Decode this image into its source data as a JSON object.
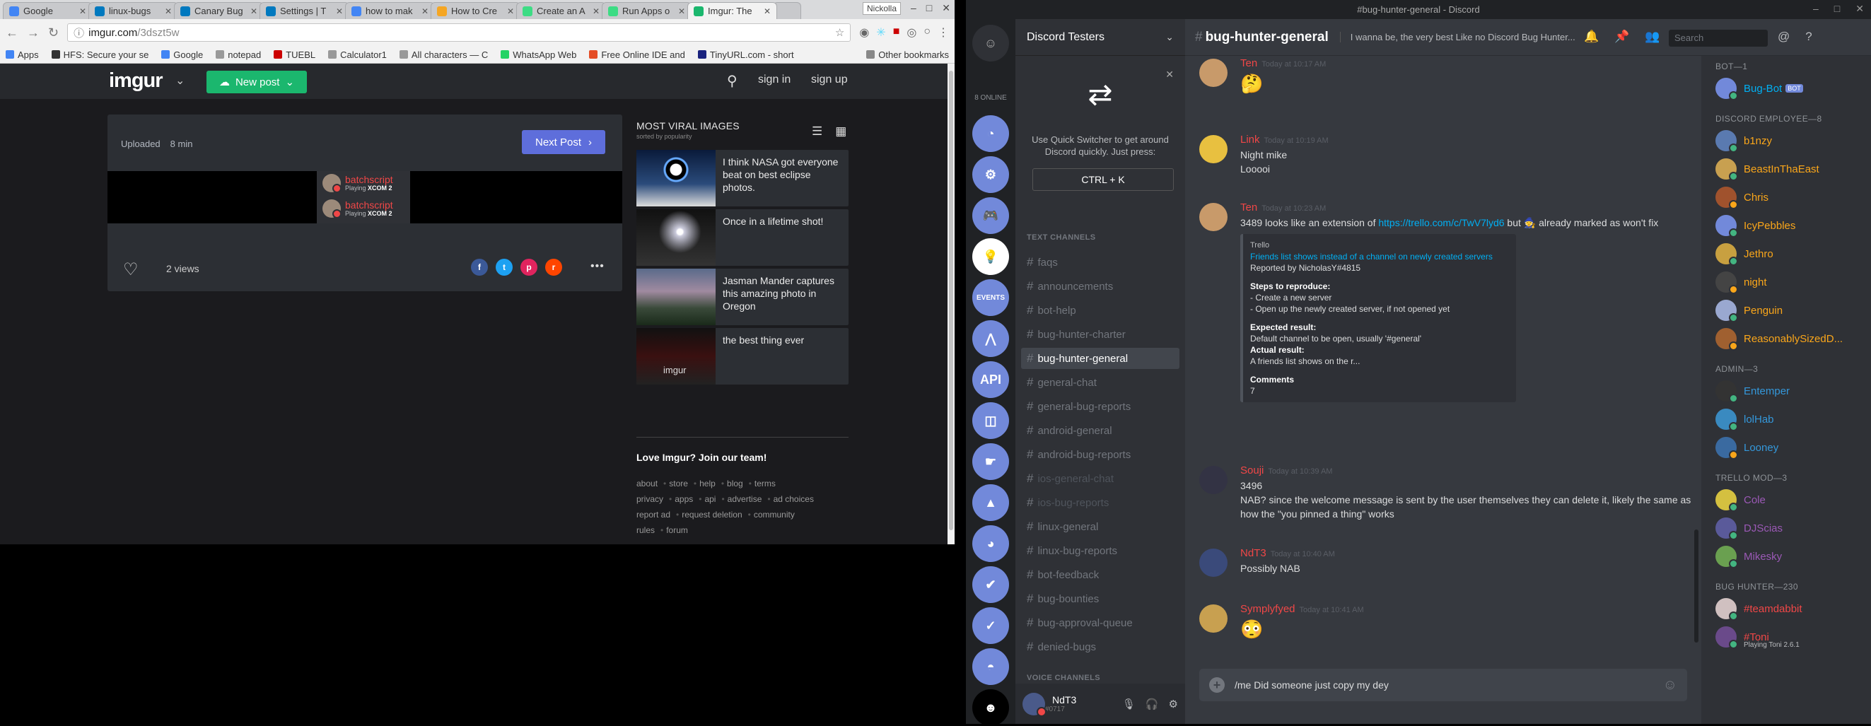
{
  "browser": {
    "tabs": [
      {
        "label": "Google",
        "color": "#4285f4"
      },
      {
        "label": "linux-bugs",
        "color": "#0079bf"
      },
      {
        "label": "Canary Bug",
        "color": "#0079bf"
      },
      {
        "label": "Settings | T",
        "color": "#0079bf"
      },
      {
        "label": "how to mak",
        "color": "#4285f4"
      },
      {
        "label": "How to Cre",
        "color": "#f5a623"
      },
      {
        "label": "Create an A",
        "color": "#3ddc84"
      },
      {
        "label": "Run Apps o",
        "color": "#3ddc84"
      },
      {
        "label": "Imgur: The",
        "color": "#1bb76e"
      }
    ],
    "profile": "Nickolla",
    "url_host": "imgur.com",
    "url_path": "/3dszt5w",
    "bookmarks": [
      "Apps",
      "HFS: Secure your se",
      "Google",
      "notepad",
      "TUEBL",
      "Calculator1",
      "All characters — C",
      "WhatsApp Web",
      "Free Online IDE and",
      "TinyURL.com - short"
    ],
    "other_bookmarks": "Other bookmarks"
  },
  "imgur": {
    "logo": "imgur",
    "new_post": "New post",
    "sign_in": "sign in",
    "sign_up": "sign up",
    "uploaded_label": "Uploaded",
    "uploaded_time": "8 min",
    "next_post": "Next Post",
    "players": [
      {
        "name": "batchscript",
        "playing": "Playing",
        "game": "XCOM 2"
      },
      {
        "name": "batchscript",
        "playing": "Playing",
        "game": "XCOM 2"
      }
    ],
    "views": "2 views",
    "share_icons": [
      {
        "glyph": "f",
        "color": "#3b5998"
      },
      {
        "glyph": "t",
        "color": "#1da1f2"
      },
      {
        "glyph": "p",
        "color": "#e0245e"
      },
      {
        "glyph": "r",
        "color": "#ff4500"
      }
    ],
    "viral_title": "MOST VIRAL IMAGES",
    "viral_sub": "sorted by popularity",
    "viral": [
      {
        "caption": "I think NASA got everyone beat on best eclipse photos."
      },
      {
        "caption": "Once in a lifetime shot!"
      },
      {
        "caption": "Jasman Mander captures this amazing photo in Oregon"
      },
      {
        "caption": "the best thing ever",
        "overlay": "imgur"
      }
    ],
    "join": "Love Imgur? Join our team!",
    "footer_links": [
      "about",
      "store",
      "help",
      "blog",
      "terms",
      "privacy",
      "apps",
      "api",
      "advertise",
      "ad choices",
      "report ad",
      "request deletion",
      "community rules",
      "forum"
    ]
  },
  "discord": {
    "window_title": "#bug-hunter-general - Discord",
    "online": "8 ONLINE",
    "server_name": "Discord Testers",
    "quick_switcher": "Use Quick Switcher to get around Discord quickly. Just press:",
    "shortcut": "CTRL + K",
    "text_channels_label": "TEXT CHANNELS",
    "voice_channels_label": "VOICE CHANNELS",
    "channels": [
      {
        "name": "faqs",
        "state": "normal"
      },
      {
        "name": "announcements",
        "state": "normal"
      },
      {
        "name": "bot-help",
        "state": "normal"
      },
      {
        "name": "bug-hunter-charter",
        "state": "normal"
      },
      {
        "name": "bug-hunter-general",
        "state": "selected"
      },
      {
        "name": "general-chat",
        "state": "normal"
      },
      {
        "name": "general-bug-reports",
        "state": "normal"
      },
      {
        "name": "android-general",
        "state": "normal"
      },
      {
        "name": "android-bug-reports",
        "state": "normal"
      },
      {
        "name": "ios-general-chat",
        "state": "dim"
      },
      {
        "name": "ios-bug-reports",
        "state": "dim"
      },
      {
        "name": "linux-general",
        "state": "normal"
      },
      {
        "name": "linux-bug-reports",
        "state": "normal"
      },
      {
        "name": "bot-feedback",
        "state": "normal"
      },
      {
        "name": "bug-bounties",
        "state": "normal"
      },
      {
        "name": "bug-approval-queue",
        "state": "normal"
      },
      {
        "name": "denied-bugs",
        "state": "normal"
      }
    ],
    "user": {
      "name": "NdT3",
      "discriminator": "#0717"
    },
    "channel_name": "bug-hunter-general",
    "topic": "I wanna be, the very best Like no Discord Bug Hunter...",
    "search_placeholder": "Search",
    "messages": [
      {
        "author": "Ten",
        "color": "#f04747",
        "time": "Today at 10:17 AM",
        "lines": [
          "🤔"
        ]
      },
      {
        "author": "Link",
        "color": "#f04747",
        "time": "Today at 10:19 AM",
        "lines": [
          "Night mike",
          "Looooi"
        ]
      },
      {
        "author": "Ten",
        "color": "#f04747",
        "time": "Today at 10:23 AM",
        "text_before": "3489 looks like an extension of ",
        "link": "https://trello.com/c/TwV7lyd6",
        "text_after": " but 🧙 already marked as won't fix",
        "embed": {
          "provider": "Trello",
          "title": "Friends list shows instead of a channel on newly created servers",
          "reporter": "Reported by NicholasY#4815",
          "steps_label": "Steps to reproduce:",
          "steps": [
            "- Create a new server",
            "- Open up the newly created server, if not opened yet"
          ],
          "expected_label": "Expected result:",
          "expected": "Default channel to be open, usually '#general'",
          "actual_label": "Actual result:",
          "actual": "A friends list shows on the r...",
          "comments_label": "Comments",
          "comments": "7"
        }
      },
      {
        "author": "Souji",
        "color": "#f04747",
        "time": "Today at 10:39 AM",
        "lines": [
          "3496",
          "NAB? since the welcome message is sent by the user themselves they can delete it, likely the same as how the \"you pinned a thing\" works"
        ]
      },
      {
        "author": "NdT3",
        "color": "#f04747",
        "time": "Today at 10:40 AM",
        "lines": [
          "Possibly NAB"
        ]
      },
      {
        "author": "Symplyfyed",
        "color": "#f04747",
        "time": "Today at 10:41 AM",
        "lines": [
          "😳"
        ]
      }
    ],
    "composer_value": "/me Did someone just copy my dey",
    "member_groups": [
      {
        "label": "BOT—1",
        "members": [
          {
            "name": "Bug-Bot",
            "color": "#00b0f4",
            "tag": "BOT"
          }
        ]
      },
      {
        "label": "DISCORD EMPLOYEE—8",
        "members": [
          {
            "name": "b1nzy",
            "color": "#faa61a"
          },
          {
            "name": "BeastInThaEast",
            "color": "#faa61a"
          },
          {
            "name": "Chris",
            "color": "#faa61a"
          },
          {
            "name": "IcyPebbles",
            "color": "#faa61a"
          },
          {
            "name": "Jethro",
            "color": "#faa61a"
          },
          {
            "name": "night",
            "color": "#faa61a"
          },
          {
            "name": "Penguin",
            "color": "#faa61a"
          },
          {
            "name": "ReasonablySizedD...",
            "color": "#faa61a"
          }
        ]
      },
      {
        "label": "ADMIN—3",
        "members": [
          {
            "name": "Entemper",
            "color": "#3498db"
          },
          {
            "name": "lolHab",
            "color": "#3498db"
          },
          {
            "name": "Looney",
            "color": "#3498db"
          }
        ]
      },
      {
        "label": "TRELLO MOD—3",
        "members": [
          {
            "name": "Cole",
            "color": "#9b59b6"
          },
          {
            "name": "DJScias",
            "color": "#9b59b6"
          },
          {
            "name": "Mikesky",
            "color": "#9b59b6"
          }
        ]
      },
      {
        "label": "BUG HUNTER—230",
        "members": [
          {
            "name": "#teamdabbit",
            "color": "#f04747"
          },
          {
            "name": "#Toni",
            "color": "#f04747",
            "game": "Playing Toni 2.6.1"
          }
        ]
      }
    ]
  }
}
